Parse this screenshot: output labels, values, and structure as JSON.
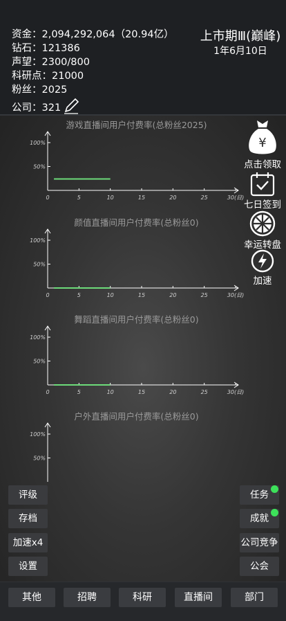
{
  "header": {
    "stats": [
      {
        "label": "资金：2,094,292,064（20.94亿）"
      },
      {
        "label": "钻石：121386"
      },
      {
        "label": "声望：2300/800"
      },
      {
        "label": "科研点：21000"
      },
      {
        "label": "粉丝：2025"
      },
      {
        "label": "公司：321"
      }
    ],
    "stage_title": "上市期Ⅲ(巅峰)",
    "date": "1年6月10日"
  },
  "charts": [
    {
      "title": "游戏直播间用户付费率(总粉丝2025)"
    },
    {
      "title": "颜值直播间用户付费率(总粉丝0)"
    },
    {
      "title": "舞蹈直播间用户付费率(总粉丝0)"
    },
    {
      "title": "户外直播间用户付费率(总粉丝0)"
    }
  ],
  "chart_data": [
    {
      "type": "line",
      "title": "游戏直播间用户付费率(总粉丝2025)",
      "x_ticks": [
        "0",
        "5",
        "10",
        "15",
        "20",
        "25",
        "30(日)"
      ],
      "y_ticks": [
        "50%",
        "100%"
      ],
      "xlim": [
        0,
        30
      ],
      "ylim": [
        0,
        100
      ],
      "series": [
        {
          "x": [
            1,
            10
          ],
          "y": [
            24,
            24
          ],
          "color": "#6ddc7a"
        }
      ]
    },
    {
      "type": "line",
      "title": "颜值直播间用户付费率(总粉丝0)",
      "x_ticks": [
        "0",
        "5",
        "10",
        "15",
        "20",
        "25",
        "30(日)"
      ],
      "y_ticks": [
        "50%",
        "100%"
      ],
      "xlim": [
        0,
        30
      ],
      "ylim": [
        0,
        100
      ],
      "series": [
        {
          "x": [
            1,
            10
          ],
          "y": [
            0,
            0
          ],
          "color": "#6ddc7a"
        }
      ]
    },
    {
      "type": "line",
      "title": "舞蹈直播间用户付费率(总粉丝0)",
      "x_ticks": [
        "0",
        "5",
        "10",
        "15",
        "20",
        "25",
        "30(日)"
      ],
      "y_ticks": [
        "50%",
        "100%"
      ],
      "xlim": [
        0,
        30
      ],
      "ylim": [
        0,
        100
      ],
      "series": [
        {
          "x": [
            1,
            10
          ],
          "y": [
            0,
            0
          ],
          "color": "#6ddc7a"
        }
      ]
    },
    {
      "type": "line",
      "title": "户外直播间用户付费率(总粉丝0)",
      "x_ticks": [],
      "y_ticks": [
        "50%",
        "100%"
      ],
      "xlim": [
        0,
        30
      ],
      "ylim": [
        0,
        100
      ],
      "series": []
    }
  ],
  "side": {
    "claim": {
      "label": "点击领取",
      "icon": "money-bag-icon",
      "symbol": "¥"
    },
    "checkin": {
      "label": "七日签到",
      "icon": "calendar-check-icon"
    },
    "wheel": {
      "label": "幸运转盘",
      "icon": "fortune-wheel-icon"
    },
    "speed": {
      "label": "加速",
      "icon": "lightning-icon"
    }
  },
  "left_buttons": [
    "评级",
    "存档",
    "加速x4",
    "设置"
  ],
  "right_buttons": [
    "任务",
    "成就",
    "公司竞争",
    "公会"
  ],
  "tabs": [
    "其他",
    "招聘",
    "科研",
    "直播间",
    "部门"
  ],
  "colors": {
    "accent_green": "#3de15a",
    "line_green": "#6ddc7a"
  }
}
